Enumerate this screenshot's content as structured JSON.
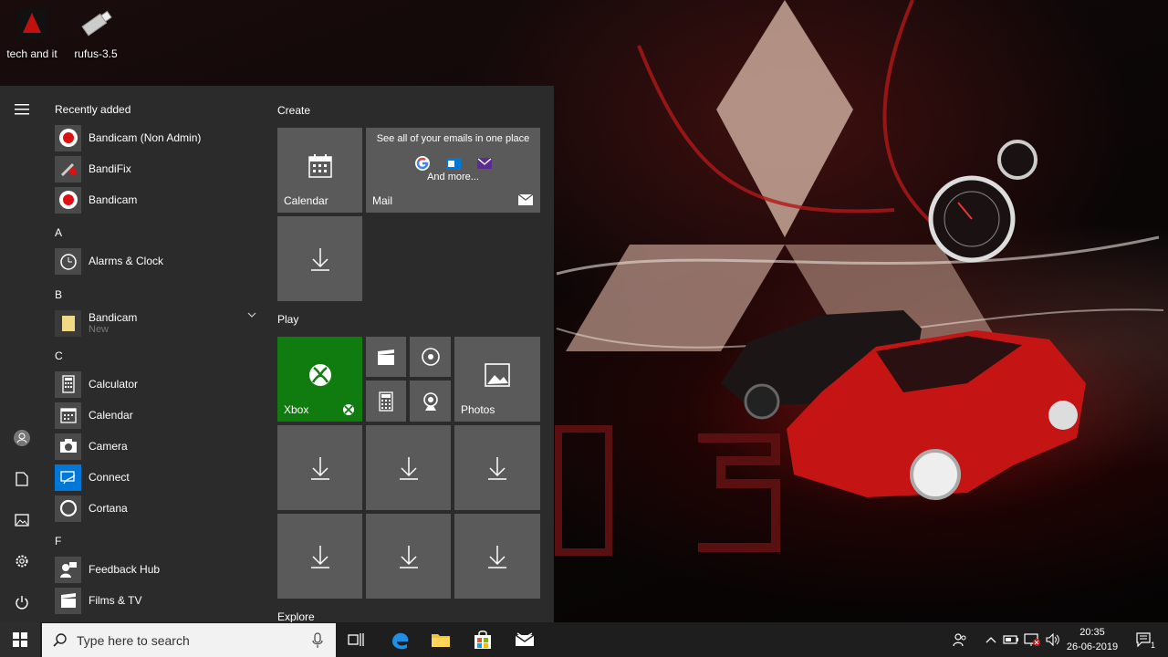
{
  "desktop": {
    "icons": [
      {
        "label": "tech and it"
      },
      {
        "label": "rufus-3.5"
      }
    ]
  },
  "start_menu": {
    "recently_added": "Recently added",
    "recent": [
      {
        "label": "Bandicam (Non Admin)"
      },
      {
        "label": "BandiFix"
      },
      {
        "label": "Bandicam"
      }
    ],
    "sections": {
      "a": "A",
      "b": "B",
      "c": "C",
      "f": "F"
    },
    "apps_a": [
      {
        "label": "Alarms & Clock"
      }
    ],
    "apps_b": [
      {
        "label": "Bandicam",
        "sub": "New"
      }
    ],
    "apps_c": [
      {
        "label": "Calculator"
      },
      {
        "label": "Calendar"
      },
      {
        "label": "Camera"
      },
      {
        "label": "Connect"
      },
      {
        "label": "Cortana"
      }
    ],
    "apps_f": [
      {
        "label": "Feedback Hub"
      },
      {
        "label": "Films & TV"
      }
    ],
    "groups": {
      "create": "Create",
      "play": "Play",
      "explore": "Explore"
    },
    "tiles": {
      "calendar": "Calendar",
      "mail": "Mail",
      "mail_promo": "See all of your emails in one place",
      "mail_more": "And more...",
      "xbox": "Xbox",
      "photos": "Photos"
    },
    "colors": {
      "xbox": "#107c10",
      "accent": "#0078d7"
    }
  },
  "taskbar": {
    "search_placeholder": "Type here to search",
    "time": "20:35",
    "date": "26-06-2019",
    "notifications": "1"
  }
}
